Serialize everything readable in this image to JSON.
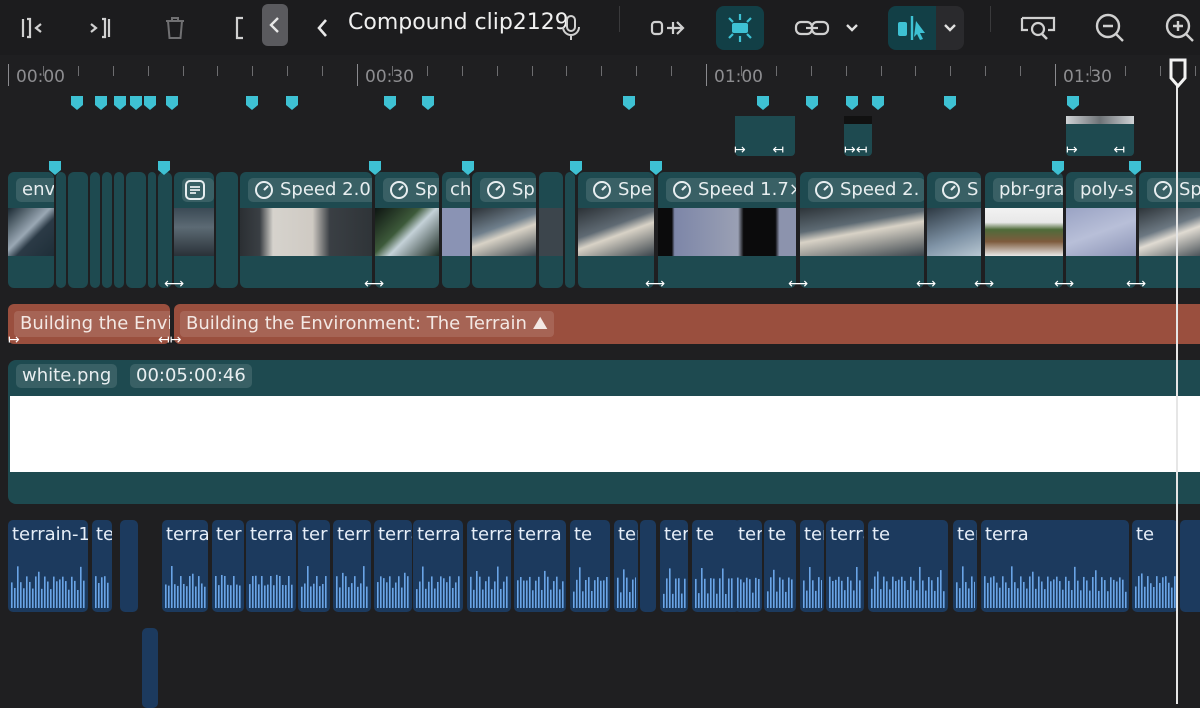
{
  "toolbar": {
    "title": "Compound clip2129",
    "icons": [
      "trim-start-icon",
      "trim-end-icon",
      "trash-icon",
      "bracket-icon",
      "collapse-chevron-icon",
      "back-chevron-icon",
      "mic-icon",
      "detach-audio-icon",
      "snapping-icon",
      "link-icon",
      "link-menu-chevron-icon",
      "select-tool-icon",
      "select-menu-chevron-icon",
      "zoom-fit-icon",
      "zoom-out-icon",
      "zoom-in-icon"
    ],
    "accent": "#3ec1d3"
  },
  "ruler": {
    "labels": [
      "00:00",
      "00:30",
      "01:00",
      "01:30"
    ]
  },
  "video_clips": [
    {
      "label": "env"
    },
    {
      "label": ""
    },
    {
      "label": "Speed 2.0"
    },
    {
      "label": "Sp"
    },
    {
      "label": "ch"
    },
    {
      "label": "Sp"
    },
    {
      "label": "Spe"
    },
    {
      "label": "Speed 1.7×"
    },
    {
      "label": "Speed 2."
    },
    {
      "label": "S"
    },
    {
      "label": "pbr-gra"
    },
    {
      "label": "poly-s"
    },
    {
      "label": "Sp"
    }
  ],
  "title_clips": [
    {
      "label": "Building the Envi"
    },
    {
      "label": "Building the Environment: The Terrain ⛰"
    }
  ],
  "image_clip": {
    "name": "white.png",
    "duration": "00:05:00:46"
  },
  "audio_clips": [
    {
      "label": "terrain-1"
    },
    {
      "label": "te"
    },
    {
      "label": "terra"
    },
    {
      "label": "ter"
    },
    {
      "label": "terra"
    },
    {
      "label": "ter"
    },
    {
      "label": "terr"
    },
    {
      "label": "terra"
    },
    {
      "label": "terra"
    },
    {
      "label": "terrai"
    },
    {
      "label": "terra"
    },
    {
      "label": "te"
    },
    {
      "label": "ter"
    },
    {
      "label": "terra"
    },
    {
      "label": "te"
    },
    {
      "label": "ter"
    },
    {
      "label": "te"
    },
    {
      "label": "terr"
    },
    {
      "label": "terrain-1"
    },
    {
      "label": "te"
    },
    {
      "label": "terrain-2-trunca"
    },
    {
      "label": "terra"
    },
    {
      "label": "te"
    }
  ]
}
